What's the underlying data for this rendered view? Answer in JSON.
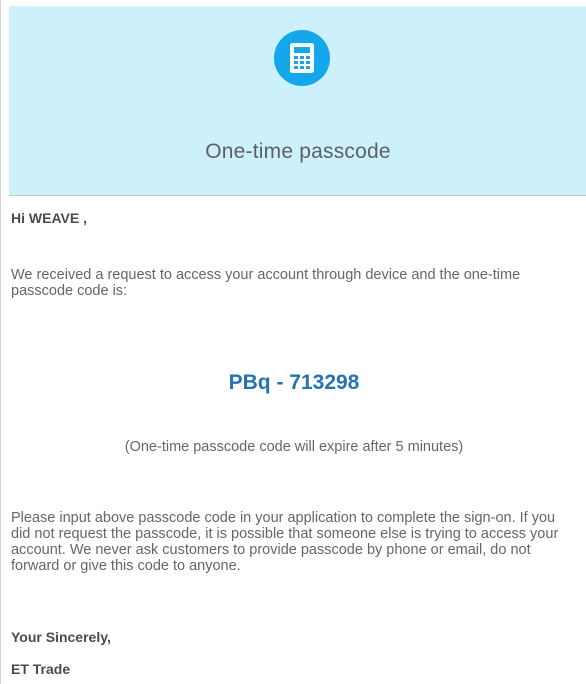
{
  "header": {
    "icon": "calculator-icon",
    "icon_bg_color": "#14a7ec",
    "background_color": "#ccf0fc",
    "title": "One-time passcode"
  },
  "email": {
    "greeting": "Hi WEAVE ,",
    "intro": "We received a request to access your account through device and the one-time passcode code is:",
    "passcode": "PBq - 713298",
    "passcode_color": "#2474b2",
    "expiry_note": "(One-time passcode code will expire after 5 minutes)",
    "instructions": "Please input above passcode code in your application to complete the sign-on. If you did not request the passcode, it is possible that someone else is trying to access your account. We never ask customers to provide passcode by phone or email, do not forward or give this code to anyone.",
    "signoff": "Your Sincerely,",
    "company": "ET Trade"
  }
}
